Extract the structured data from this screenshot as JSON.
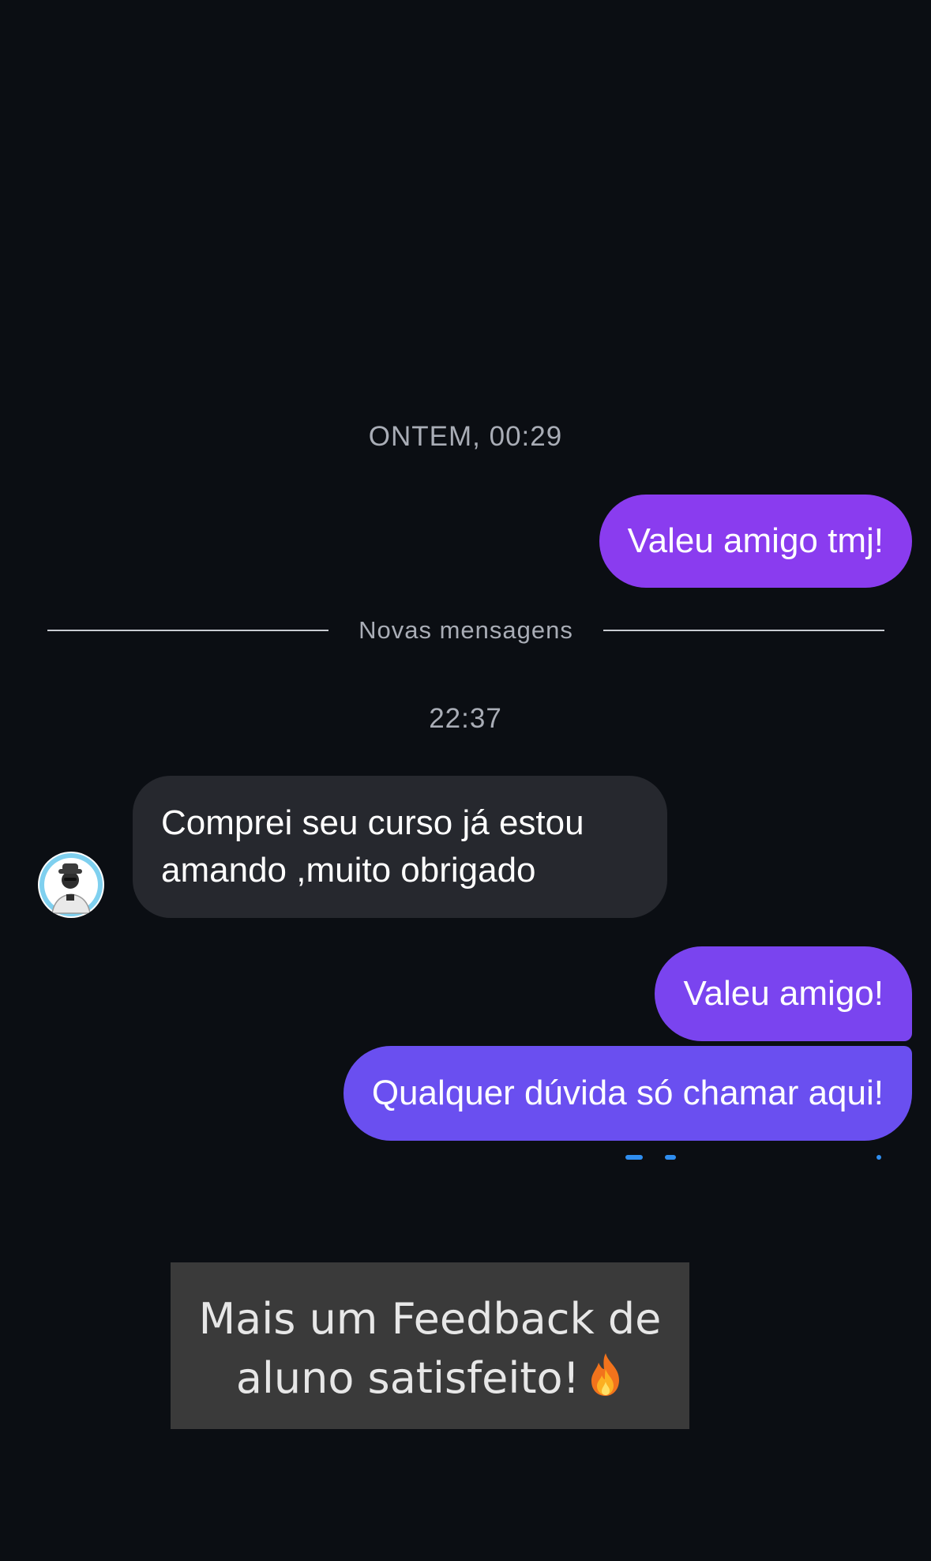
{
  "chat": {
    "day_stamp": "ONTEM, 00:29",
    "new_messages_label": "Novas mensagens",
    "time_stamp": "22:37",
    "messages": [
      {
        "direction": "outgoing",
        "text": "Valeu amigo tmj!"
      },
      {
        "direction": "incoming",
        "lines": [
          "Comprei seu curso já estou",
          "amando ,muito obrigado"
        ]
      },
      {
        "direction": "outgoing",
        "text": "Valeu amigo!"
      },
      {
        "direction": "outgoing",
        "text": "Qualquer dúvida só chamar aqui!"
      }
    ]
  },
  "caption": {
    "line1": "Mais um Feedback de",
    "line2": "aluno satisfeito!",
    "emoji_icon": "fire-icon"
  },
  "colors": {
    "background": "#0b0e13",
    "outgoing_bubble_1": "#8a3cef",
    "outgoing_bubble_2": "#7a44ef",
    "outgoing_bubble_3": "#6a4ff0",
    "incoming_bubble": "#26282e",
    "caption_box": "#3a3a3a",
    "seen_indicator": "#2f8ef0"
  }
}
